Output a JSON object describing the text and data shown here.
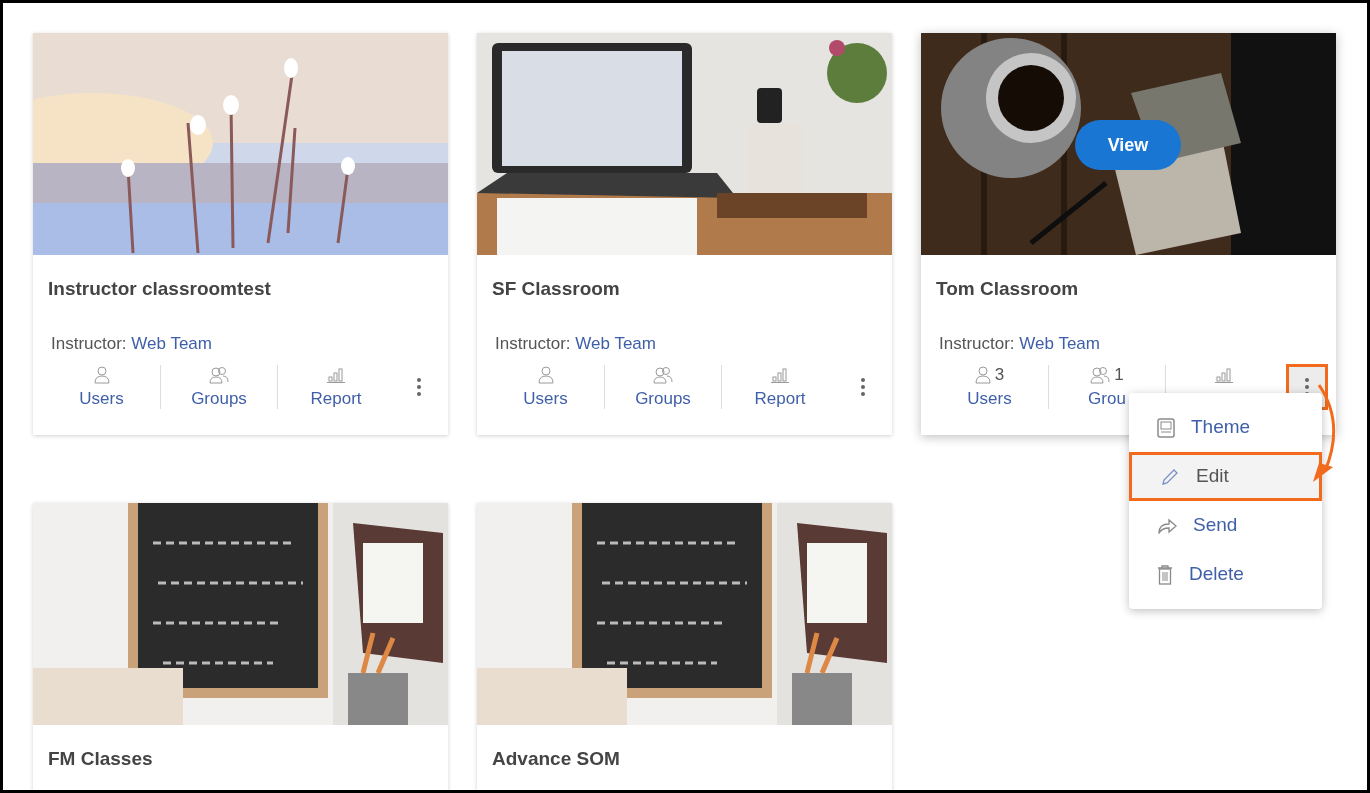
{
  "cards": [
    {
      "image": {
        "kind": "picture"
      },
      "title": "Instructor classroomtest",
      "instructor_label": "Instructor:",
      "instructor": "Web Team",
      "hovered": false,
      "more_outlined": false,
      "stats": [
        {
          "kind": "users",
          "label": "Users"
        },
        {
          "kind": "groups",
          "label": "Groups"
        },
        {
          "kind": "report",
          "label": "Report"
        }
      ]
    },
    {
      "image": {
        "kind": "picture"
      },
      "title": "SF Classroom",
      "instructor_label": "Instructor:",
      "instructor": "Web Team",
      "hovered": false,
      "more_outlined": false,
      "stats": [
        {
          "kind": "users",
          "label": "Users"
        },
        {
          "kind": "groups",
          "label": "Groups"
        },
        {
          "kind": "report",
          "label": "Report"
        }
      ]
    },
    {
      "image": {
        "kind": "picture"
      },
      "title": "Tom Classroom",
      "instructor_label": "Instructor:",
      "instructor": "Web Team",
      "hovered": true,
      "view_button": "View",
      "stats": [
        {
          "kind": "users",
          "count": "3",
          "label": "Users"
        },
        {
          "kind": "groups",
          "count": "1",
          "label": "Grou"
        },
        {
          "kind": "report"
        }
      ],
      "more_outlined": true,
      "menu": [
        {
          "kind": "theme",
          "label": "Theme",
          "highlighted": false,
          "outlined": false
        },
        {
          "kind": "edit",
          "label": "Edit",
          "highlighted": true,
          "outlined": true
        },
        {
          "kind": "send",
          "label": "Send",
          "highlighted": false,
          "outlined": false
        },
        {
          "kind": "delete",
          "label": "Delete",
          "highlighted": false,
          "outlined": false
        }
      ]
    },
    {
      "image": {
        "kind": "picture"
      },
      "title": "FM Classes",
      "hovered": false
    },
    {
      "image": {
        "kind": "picture"
      },
      "title": "Advance SOM",
      "hovered": false
    }
  ]
}
